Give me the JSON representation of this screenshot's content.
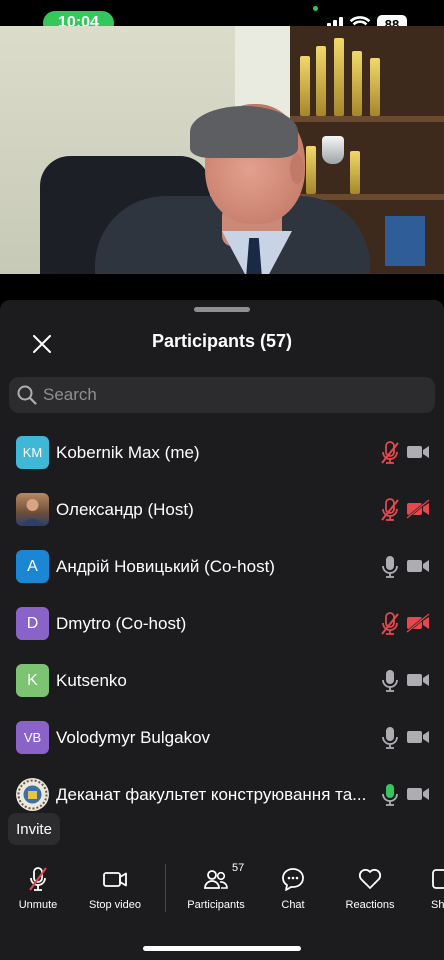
{
  "status_bar": {
    "time": "10:04",
    "battery": "88",
    "icons": [
      "signal-icon",
      "wifi-icon",
      "battery-icon"
    ]
  },
  "video": {
    "description_icon": "participant-video-feed"
  },
  "panel": {
    "title": "Participants (57)",
    "search_placeholder": "Search",
    "close_icon": "close-icon"
  },
  "participants": [
    {
      "initials": "KM",
      "name": "Kobernik Max (me)",
      "avatar_color": "#3fb7d6",
      "mic": "muted",
      "video": "off"
    },
    {
      "initials": "",
      "name": "Олександр (Host)",
      "avatar_color": "#7a5a44",
      "mic": "muted",
      "video": "off-red"
    },
    {
      "initials": "A",
      "name": "Андрій Новицький (Co-host)",
      "avatar_color": "#1a86d4",
      "mic": "on",
      "video": "off"
    },
    {
      "initials": "D",
      "name": "Dmytro (Co-host)",
      "avatar_color": "#8a63c9",
      "mic": "muted",
      "video": "off-red"
    },
    {
      "initials": "K",
      "name": "Kutsenko",
      "avatar_color": "#7cc472",
      "mic": "on",
      "video": "off"
    },
    {
      "initials": "VB",
      "name": "Volodymyr Bulgakov",
      "avatar_color": "#8a63c9",
      "mic": "on",
      "video": "off"
    },
    {
      "initials": "",
      "name": "Деканат факультет конструювання та...",
      "avatar_color": "#e6e2d8",
      "mic": "speaking",
      "video": "off"
    }
  ],
  "invite": {
    "label": "Invite"
  },
  "toolbar": {
    "unmute": "Unmute",
    "stop_video": "Stop video",
    "participants": "Participants",
    "participants_count": "57",
    "chat": "Chat",
    "reactions": "Reactions",
    "share": "Sh"
  },
  "colors": {
    "muted_red": "#e5484d",
    "icon_gray": "#aeaeb2",
    "speaking_green": "#34c759",
    "panel_bg": "#1c1c1e"
  }
}
